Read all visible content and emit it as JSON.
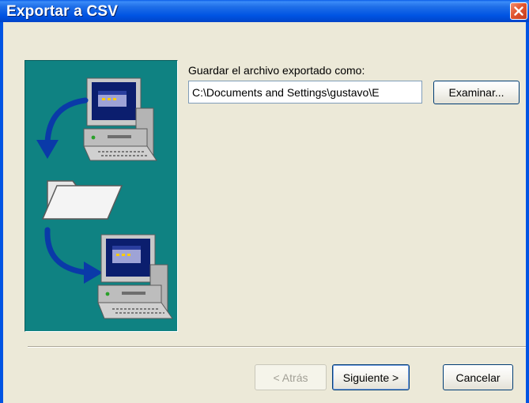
{
  "window": {
    "title": "Exportar a CSV"
  },
  "form": {
    "save_label": "Guardar el archivo exportado como:",
    "path_value": "C:\\Documents and Settings\\gustavo\\E",
    "browse_label": "Examinar..."
  },
  "buttons": {
    "back_label": "< Atrás",
    "next_label": "Siguiente >",
    "cancel_label": "Cancelar"
  },
  "icons": {
    "close": "close-icon",
    "illustration": [
      "computer-icon",
      "arrow-down-icon",
      "folder-icon",
      "arrow-right-icon",
      "computer-icon"
    ]
  },
  "colors": {
    "titlebar": "#0054e3",
    "close_button": "#e2552f",
    "dialog_background": "#ece9d8",
    "illustration_background": "#0f8282"
  }
}
